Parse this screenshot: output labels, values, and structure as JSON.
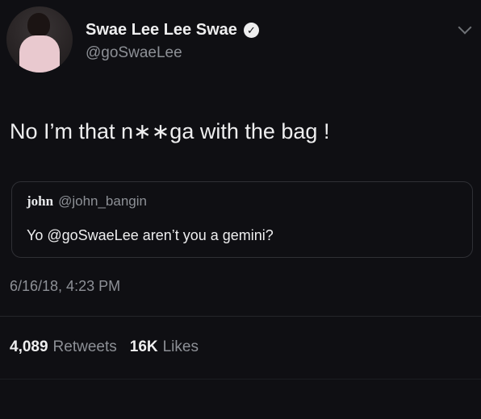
{
  "author": {
    "display_name": "Swae Lee Lee Swae",
    "handle": "@goSwaeLee",
    "verified_icon": "verified-badge-icon"
  },
  "tweet": {
    "text": "No I’m that n∗∗ga with the bag !",
    "timestamp": "6/16/18, 4:23 PM"
  },
  "quoted_tweet": {
    "name": "john",
    "handle": "@john_bangin",
    "text": "Yo @goSwaeLee aren’t you a gemini?"
  },
  "stats": {
    "retweets_count": "4,089",
    "retweets_label": "Retweets",
    "likes_count": "16K",
    "likes_label": "Likes"
  },
  "colors": {
    "background": "#0f0f13",
    "primary_text": "#eeeeef",
    "secondary_text": "#8d9096"
  }
}
